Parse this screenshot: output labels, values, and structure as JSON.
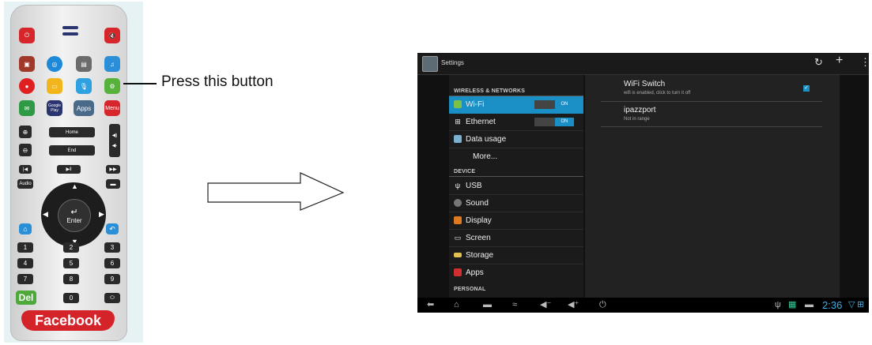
{
  "remote": {
    "callout": "Press this button",
    "google_play_label": "Google Play",
    "apps_label": "Apps",
    "menu_label": "Menu",
    "home_label": "Home",
    "end_label": "End",
    "audio_label": "Audio",
    "enter_label": "Enter",
    "keys": [
      "1",
      "2",
      "3",
      "4",
      "5",
      "6",
      "7",
      "8",
      "9",
      "0"
    ],
    "del_label": "Del",
    "facebook_label": "Facebook"
  },
  "tablet": {
    "title": "Settings",
    "categories": {
      "wireless": "WIRELESS & NETWORKS",
      "device": "DEVICE",
      "personal": "PERSONAL"
    },
    "items": [
      {
        "label": "Wi-Fi",
        "icon": "wifi-icon",
        "toggle": "ON"
      },
      {
        "label": "Ethernet",
        "icon": "ethernet-icon",
        "toggle": "ON"
      },
      {
        "label": "Data usage",
        "icon": "data-usage-icon"
      },
      {
        "label": "More...",
        "icon": ""
      },
      {
        "label": "USB",
        "icon": "usb-icon"
      },
      {
        "label": "Sound",
        "icon": "sound-icon"
      },
      {
        "label": "Display",
        "icon": "display-icon"
      },
      {
        "label": "Screen",
        "icon": "screen-icon"
      },
      {
        "label": "Storage",
        "icon": "storage-icon"
      },
      {
        "label": "Apps",
        "icon": "apps-icon"
      }
    ],
    "wifi": {
      "switch_title": "WiFi Switch",
      "switch_sub": "wifi is enabled, click to turn it off",
      "network_name": "ipazzport",
      "network_status": "Not in range"
    },
    "clock": "2:36"
  },
  "colors": {
    "accent": "#1a8fc5",
    "facebook": "#d5232a",
    "clock": "#3cb0e6"
  }
}
